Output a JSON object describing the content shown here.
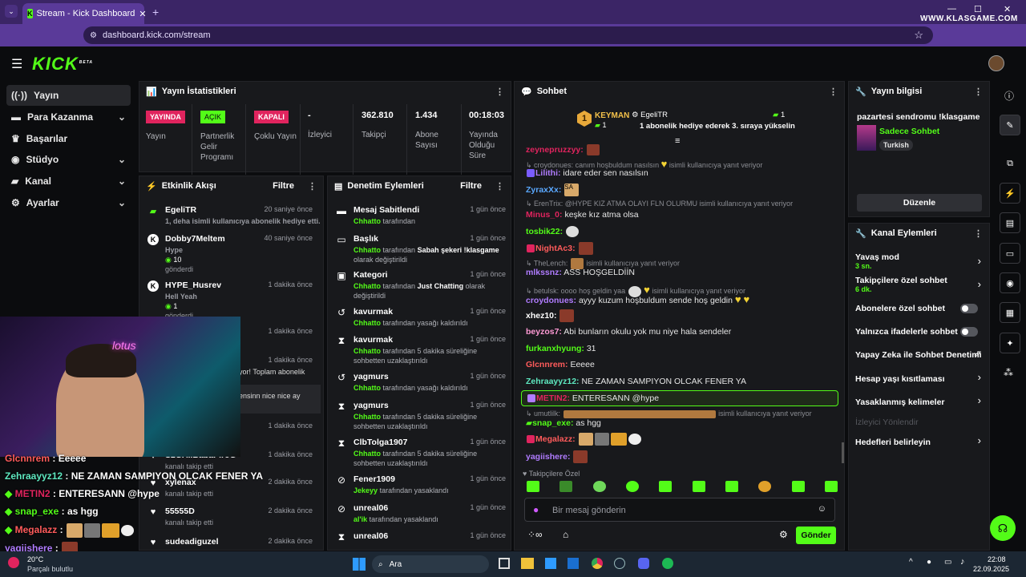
{
  "browser": {
    "tab_title": "Stream - Kick Dashboard",
    "url": "dashboard.kick.com/stream",
    "watermark": "WWW.KLASGAME.COM"
  },
  "logo": "KICK",
  "logo_beta": "BETA",
  "nav": [
    {
      "label": "Yayın",
      "icon": "radio-icon"
    },
    {
      "label": "Para Kazanma",
      "icon": "money-icon"
    },
    {
      "label": "Başarılar",
      "icon": "trophy-icon"
    },
    {
      "label": "Stüdyo",
      "icon": "studio-icon"
    },
    {
      "label": "Kanal",
      "icon": "channel-icon"
    },
    {
      "label": "Ayarlar",
      "icon": "gear-icon"
    }
  ],
  "stats": {
    "title": "Yayın İstatistikleri",
    "live_badge": "YAYINDA",
    "live_label": "Yayın",
    "partner_badge": "AÇIK",
    "partner_label": "Partnerlik Gelir Programı",
    "multi_badge": "KAPALI",
    "multi_label": "Çoklu Yayın",
    "viewers_value": "-",
    "viewers_label": "İzleyici",
    "followers_value": "362.810",
    "followers_label": "Takipçi",
    "subs_value": "1.434",
    "subs_label": "Abone Sayısı",
    "uptime_value": "00:18:03",
    "uptime_label": "Yayında Olduğu Süre"
  },
  "activity": {
    "title": "Etkinlik Akışı",
    "filter": "Filtre",
    "items": [
      {
        "name": "EgeliTR",
        "time": "20 saniye önce",
        "sub": "1, deha isimli kullanıcıya abonelik hediye etti."
      },
      {
        "name": "Dobby7Meltem",
        "time": "40 saniye önce",
        "sub1": "Hype",
        "sub2": "10",
        "sub3": "gönderdi"
      },
      {
        "name": "HYPE_Husrev",
        "time": "1 dakika önce",
        "sub1": "Hell Yeah",
        "sub2": "1",
        "sub3": "gönderdi"
      },
      {
        "time": "1 dakika önce"
      },
      {
        "time": "1 dakika önce",
        "sub": "yor! Toplam abonelik"
      },
      {
        "sub": "ensinn nice nice ay"
      },
      {
        "time": "1 dakika önce"
      },
      {
        "name": "S2GAliBabaPiroG",
        "time": "1 dakika önce",
        "sub": "kanalı takip etti"
      },
      {
        "name": "xylenax",
        "time": "2 dakika önce",
        "sub": "kanalı takip etti"
      },
      {
        "name": "55555D",
        "time": "2 dakika önce",
        "sub": "kanalı takip etti"
      },
      {
        "name": "sudeadiguzel",
        "time": "2 dakika önce"
      }
    ]
  },
  "moderation": {
    "title": "Denetim Eylemleri",
    "filter": "Filtre",
    "items": [
      {
        "name": "Mesaj Sabitlendi",
        "time": "1 gün önce",
        "who": "Chhatto",
        "text": "tarafından"
      },
      {
        "name": "Başlık",
        "time": "1 gün önce",
        "who": "Chhatto",
        "text": "tarafından",
        "value": "Sabah şekeri !klasgame",
        "tail": "olarak değiştirildi"
      },
      {
        "name": "Kategori",
        "time": "1 gün önce",
        "who": "Chhatto",
        "text": "tarafından",
        "value": "Just Chatting",
        "tail": "olarak değiştirildi"
      },
      {
        "name": "kavurmak",
        "time": "1 gün önce",
        "who": "Chhatto",
        "text": "tarafından yasağı kaldırıldı"
      },
      {
        "name": "kavurmak",
        "time": "1 gün önce",
        "who": "Chhatto",
        "text": "tarafından 5 dakika süreliğine sohbetten uzaklaştırıldı"
      },
      {
        "name": "yagmurs",
        "time": "1 gün önce",
        "who": "Chhatto",
        "text": "tarafından yasağı kaldırıldı"
      },
      {
        "name": "yagmurs",
        "time": "1 gün önce",
        "who": "Chhatto",
        "text": "tarafından 5 dakika süreliğine sohbetten uzaklaştırıldı"
      },
      {
        "name": "ClbTolga1907",
        "time": "1 gün önce",
        "who": "Chhatto",
        "text": "tarafından 5 dakika süreliğine sohbetten uzaklaştırıldı"
      },
      {
        "name": "Fener1909",
        "time": "1 gün önce",
        "who": "Jekeyy",
        "text": "tarafından yasaklandı"
      },
      {
        "name": "unreal06",
        "time": "1 gün önce",
        "who": "al'ik",
        "text": "tarafından yasaklandı"
      },
      {
        "name": "unreal06",
        "time": "1 gün önce"
      }
    ]
  },
  "chat": {
    "title": "Sohbet",
    "leader_name": "KEYMAN",
    "leader_count": "1",
    "leader_rank": "1",
    "gifter_name": "EgeliTR",
    "gifter_count": "1",
    "gifter_msg": "1 abonelik hediye ederek 3. sıraya yükselin",
    "lines": [
      {
        "user": "zeynepruzzyy:"
      },
      {
        "reply": "croydonues: canım hoşbuldum nasılsın",
        "reply_tail": "isimli kullanıcıya yanıt veriyor"
      },
      {
        "user": "Lilithi:",
        "text": "idare eder sen nasılsın"
      },
      {
        "user": "ZyraxXx:",
        "emote": "SA"
      },
      {
        "reply": "ErenTrix: @HYPE KIZ ATMA OLAYI FLN OLURMU isimli kullanıcıya yanıt veriyor"
      },
      {
        "user": "Minus_0:",
        "text": "keşke kız atma olsa"
      },
      {
        "user": "tosbik22:"
      },
      {
        "user": "NightAc3:"
      },
      {
        "reply": "TheLench:",
        "reply_tail": "isimli kullanıcıya yanıt veriyor"
      },
      {
        "user": "mlkssnz:",
        "text": "ASS HOŞGELDİİN"
      },
      {
        "reply": "betulsk: oooo hoş geldin yaa",
        "reply_tail": "isimli kullanıcıya yanıt veriyor"
      },
      {
        "user": "croydonues:",
        "text": "ayyy kuzum hoşbuldum sende hoş geldin"
      },
      {
        "user": "xhez10:"
      },
      {
        "user": "beyzos7:",
        "text": "Abi bunların okulu yok mu niye hala sendeler"
      },
      {
        "user": "furkanxhyung:",
        "text": "31"
      },
      {
        "user": "Glcnnrem:",
        "text": "Eeeee"
      },
      {
        "user": "Zehraayyz12:",
        "text": "NE ZAMAN SAMPIYON OLCAK FENER YA"
      },
      {
        "user": "METIN2:",
        "text": "ENTERESANN @hype"
      },
      {
        "reply": "umutlilk:",
        "reply_tail": "isimli kullanıcıya yanıt veriyor"
      },
      {
        "user": "snap_exe:",
        "text": "as hgg"
      },
      {
        "user": "Megalazz:"
      },
      {
        "user": "yagiishere:"
      }
    ],
    "followers_only": "Takipçilere Özel",
    "input_placeholder": "Bir mesaj gönderin",
    "send": "Gönder"
  },
  "stream_info": {
    "title": "Yayın bilgisi",
    "stream_title": "pazartesi sendromu !klasgame",
    "category": "Sadece Sohbet",
    "tag": "Turkish",
    "edit": "Düzenle"
  },
  "channel_actions": {
    "title": "Kanal Eylemleri",
    "slow_mode": "Yavaş mod",
    "slow_val": "3 sn.",
    "followers_chat": "Takipçilere özel sohbet",
    "followers_val": "6 dk.",
    "subs_chat": "Abonelere özel sohbet",
    "emotes_chat": "Yalnızca ifadelerle sohbet",
    "ai_mod": "Yapay Zeka ile Sohbet Denetimi",
    "age": "Hesap yaşı kısıtlaması",
    "banned": "Yasaklanmış kelimeler",
    "redirect": "İzleyici Yönlendir",
    "goals": "Hedefleri belirleyin"
  },
  "overlay": {
    "lines": [
      {
        "user": "Glcnnrem",
        "text": "Eeeee"
      },
      {
        "user": "Zehraayyz12",
        "text": "NE ZAMAN SAMPIYON OLCAK FENER YA"
      },
      {
        "user": "METIN2",
        "text": "ENTERESANN @hype"
      },
      {
        "user": "snap_exe",
        "text": "as hgg"
      },
      {
        "user": "Megalazz",
        "text": ""
      },
      {
        "user": "yagiishere",
        "text": ""
      }
    ]
  },
  "taskbar": {
    "weather_temp": "20°C",
    "weather_desc": "Parçalı bulutlu",
    "search": "Ara",
    "time": "22:08",
    "date": "22.09.2025"
  },
  "colors": {
    "accent": "#53fc18",
    "browser": "#5a3a99",
    "live": "#e0245e"
  }
}
